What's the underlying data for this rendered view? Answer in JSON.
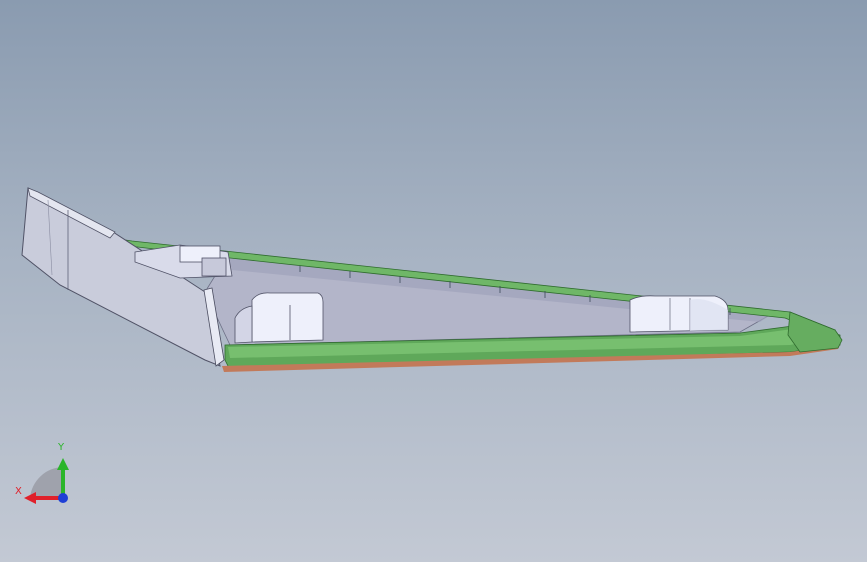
{
  "viewport": {
    "background_top": "#8a9bb0",
    "background_bottom": "#c3c9d4"
  },
  "model": {
    "part_colors": {
      "shell_face": "#c9ccdb",
      "inner_floor": "#b7b9cc",
      "rim_green": "#5fa85a",
      "rim_dark": "#2f6b2e",
      "boss_white": "#eef0fb",
      "base_edge": "#c27a5a"
    }
  },
  "triad": {
    "x_label": "X",
    "y_label": "Y",
    "x_color": "#e0202a",
    "y_color": "#2ab52a",
    "z_color": "#1f3fd6"
  }
}
